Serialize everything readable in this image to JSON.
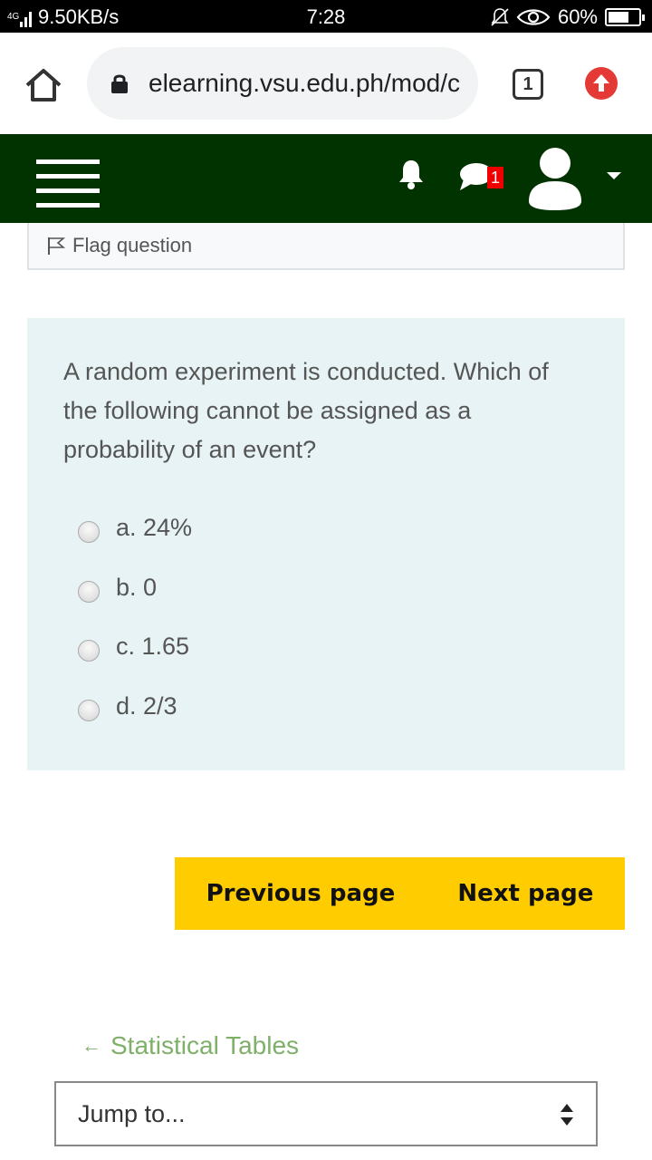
{
  "status_bar": {
    "network_type": "4G",
    "data_speed": "9.50KB/s",
    "time": "7:28",
    "battery": "60%"
  },
  "browser": {
    "url": "elearning.vsu.edu.ph/mod/c",
    "tab_count": "1"
  },
  "nav": {
    "message_badge": "1"
  },
  "flag": {
    "label": "Flag question"
  },
  "question": {
    "text": "A random experiment is conducted. Which of the following cannot be assigned as a probability of an event?",
    "options": [
      {
        "label": "a. 24%"
      },
      {
        "label": "b. 0"
      },
      {
        "label": "c. 1.65"
      },
      {
        "label": "d. 2/3"
      }
    ]
  },
  "buttons": {
    "previous": "Previous page",
    "next": "Next page"
  },
  "back_link": {
    "arrow": "←",
    "label": "Statistical Tables"
  },
  "jump": {
    "label": "Jump to..."
  },
  "colors": {
    "navbar": "#013300",
    "question_bg": "#e7f3f5",
    "button_bg": "#ffcc00",
    "link": "#7fb069",
    "badge": "#ee0000"
  }
}
